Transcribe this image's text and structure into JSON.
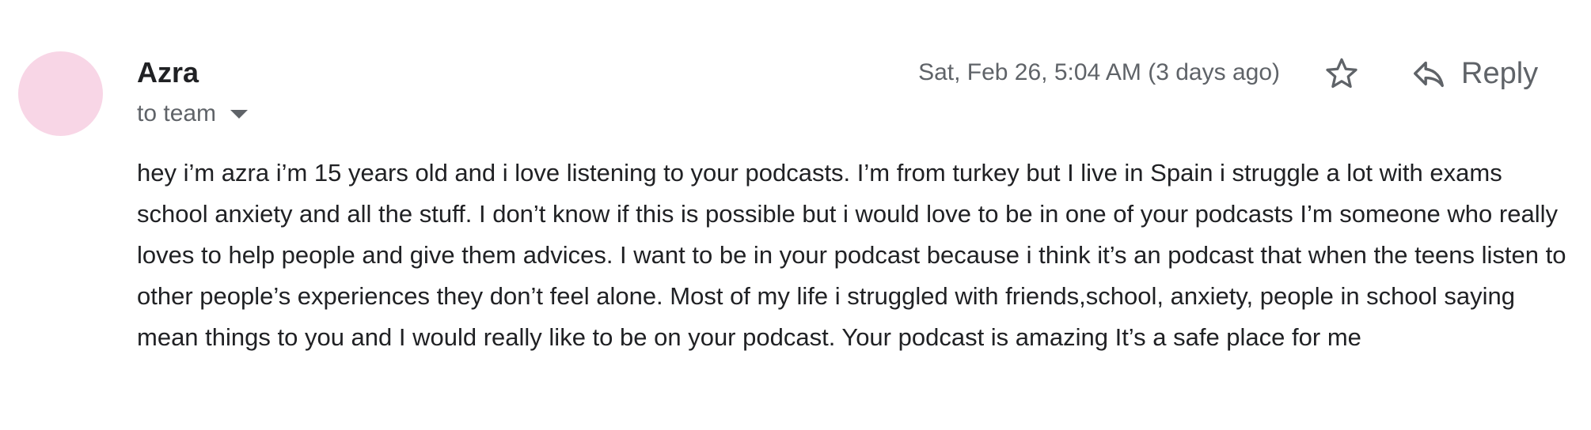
{
  "message": {
    "sender_name": "Azra",
    "recipient_label": "to team",
    "date": "Sat, Feb 26, 5:04 AM (3 days ago)",
    "reply_label": "Reply",
    "body": "hey i’m azra i’m 15 years old and i love listening to your podcasts. I’m from turkey but I live in Spain i struggle a lot with exams school anxiety and all the stuff. I don’t know if this is possible but i would love to be in one of your podcasts I’m someone who really loves to help people and give them advices. I want to be in your podcast because i think it’s an podcast that when the teens listen to other people’s experiences they don’t feel alone. Most of my life i struggled with friends,school, anxiety, people in school saying mean things to you and I would really like to be on your podcast. Your podcast is amazing It’s a safe place for me"
  },
  "icons": {
    "recipient_caret": "caret-down-icon",
    "star": "star-icon",
    "reply": "reply-arrow-icon"
  },
  "colors": {
    "avatar_bg": "#f8d6e6",
    "secondary_text": "#5f6368",
    "primary_text": "#202124"
  }
}
